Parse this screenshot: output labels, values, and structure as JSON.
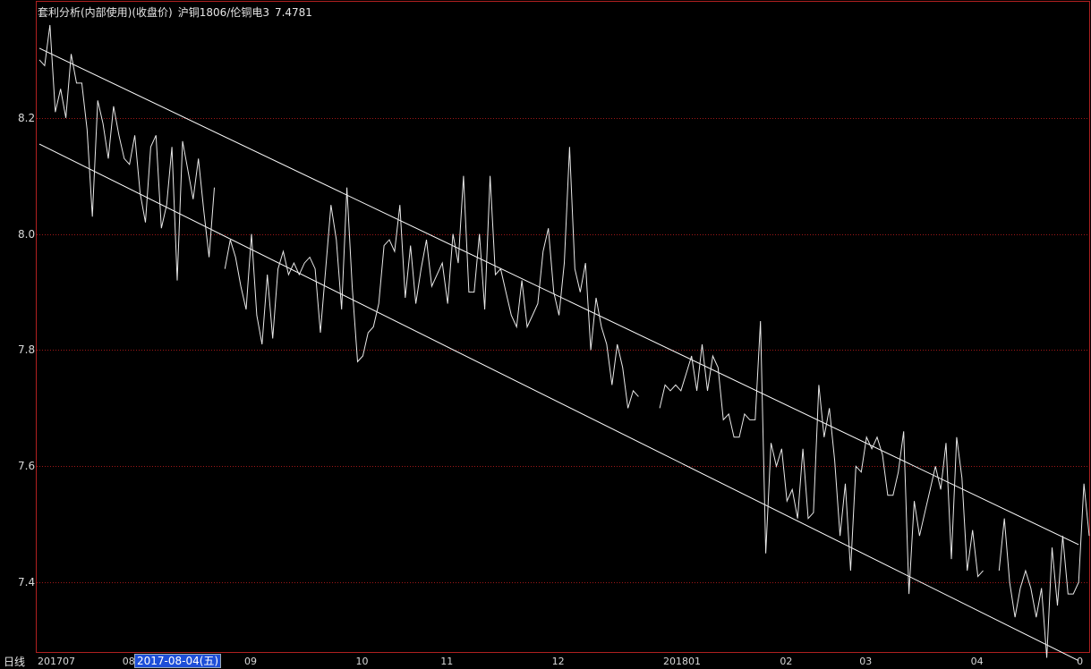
{
  "header": {
    "analysis_title": "套利分析(内部使用)(收盘价)",
    "pair_name": "沪铜1806/伦铜电3",
    "last_value": "7.4781"
  },
  "period_label": "日线",
  "cursor_date": "2017-08-04(五)",
  "colors": {
    "background": "#000000",
    "series": "#e8e8e8",
    "channel": "#ffffff",
    "grid": "#a01818",
    "frame": "#b02020",
    "cursor_highlight": "#1e4fd8"
  },
  "chart_data": {
    "type": "line",
    "title": "套利分析(内部使用)(收盘价) 沪铜1806/伦铜电3",
    "ylim": [
      7.28,
      8.4
    ],
    "y_ticks": [
      7.4,
      7.6,
      7.8,
      8.0,
      8.2
    ],
    "y_tick_labels": [
      "7.4",
      "7.6",
      "7.8",
      "8.0",
      "8.2"
    ],
    "grid": "horizontal dotted",
    "x_tick_labels": [
      {
        "label": "201707",
        "index": 0
      },
      {
        "label": "08",
        "index": 16
      },
      {
        "label": "09",
        "index": 39
      },
      {
        "label": "10",
        "index": 60
      },
      {
        "label": "11",
        "index": 76
      },
      {
        "label": "12",
        "index": 97
      },
      {
        "label": "201801",
        "index": 118
      },
      {
        "label": "02",
        "index": 140
      },
      {
        "label": "03",
        "index": 155
      },
      {
        "label": "04",
        "index": 176
      },
      {
        "label": "0",
        "index": 196
      }
    ],
    "series": [
      {
        "values": [
          8.3,
          8.29,
          8.36,
          8.21,
          8.25,
          8.2,
          8.31,
          8.26,
          8.26,
          8.18,
          8.03,
          8.23,
          8.19,
          8.13,
          8.22,
          8.17,
          8.13,
          8.12,
          8.17,
          8.07,
          8.02,
          8.15,
          8.17,
          8.01,
          8.05,
          8.15,
          7.92,
          8.16,
          8.11,
          8.06,
          8.13,
          8.04,
          7.96,
          8.08,
          null,
          7.94,
          7.99,
          7.96,
          7.91,
          7.87,
          8.0,
          7.86,
          7.81,
          7.93,
          7.82,
          7.94,
          7.97,
          7.93,
          7.95,
          7.93,
          7.95,
          7.96,
          7.94,
          7.83,
          7.94,
          8.05,
          7.99,
          7.87,
          8.08,
          7.91,
          7.78,
          7.79,
          7.83,
          7.84,
          7.88,
          7.98,
          7.99,
          7.97,
          8.05,
          7.89,
          7.98,
          7.88,
          7.94,
          7.99,
          7.91,
          7.93,
          7.95,
          7.88,
          8.0,
          7.95,
          8.1,
          7.9,
          7.9,
          8.0,
          7.87,
          8.1,
          7.93,
          7.94,
          7.9,
          7.86,
          7.84,
          7.92,
          7.84,
          7.86,
          7.88,
          7.97,
          8.01,
          7.9,
          7.86,
          7.95,
          8.15,
          7.94,
          7.9,
          7.95,
          7.8,
          7.89,
          7.84,
          7.81,
          7.74,
          7.81,
          7.77,
          7.7,
          7.73,
          7.72,
          null,
          null,
          null,
          7.7,
          7.74,
          7.73,
          7.74,
          7.73,
          7.76,
          7.79,
          7.73,
          7.81,
          7.73,
          7.79,
          7.77,
          7.68,
          7.69,
          7.65,
          7.65,
          7.69,
          7.68,
          7.68,
          7.85,
          7.45,
          7.64,
          7.6,
          7.63,
          7.54,
          7.56,
          7.51,
          7.63,
          7.51,
          7.52,
          7.74,
          7.65,
          7.7,
          7.61,
          7.48,
          7.57,
          7.42,
          7.6,
          7.59,
          7.65,
          7.63,
          7.65,
          7.62,
          7.55,
          7.55,
          7.59,
          7.66,
          7.38,
          7.54,
          7.48,
          7.52,
          7.56,
          7.6,
          7.56,
          7.64,
          7.44,
          7.65,
          7.58,
          7.42,
          7.49,
          7.41,
          7.42,
          null,
          null,
          7.42,
          7.51,
          7.4,
          7.34,
          7.39,
          7.42,
          7.39,
          7.34,
          7.39,
          7.27,
          7.46,
          7.36,
          7.48,
          7.38,
          7.38,
          7.4,
          7.57,
          7.48
        ]
      }
    ],
    "channel_lines": [
      {
        "from": {
          "index": 0,
          "value": 8.32
        },
        "to": {
          "index": 196,
          "value": 7.465
        }
      },
      {
        "from": {
          "index": 0,
          "value": 8.155
        },
        "to": {
          "index": 196,
          "value": 7.265
        }
      }
    ]
  }
}
